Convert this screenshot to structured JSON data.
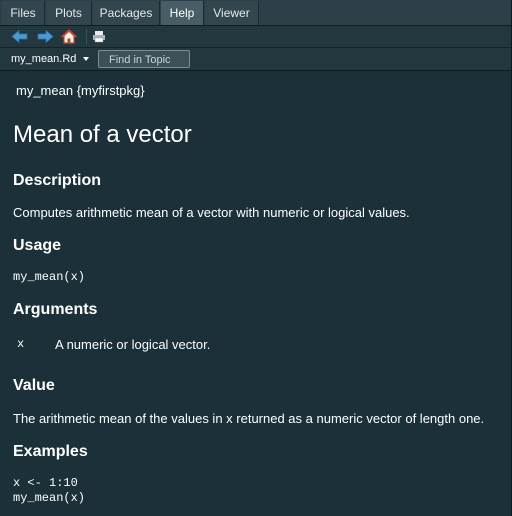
{
  "tabs": [
    {
      "label": "Files",
      "active": false
    },
    {
      "label": "Plots",
      "active": false
    },
    {
      "label": "Packages",
      "active": false
    },
    {
      "label": "Help",
      "active": true
    },
    {
      "label": "Viewer",
      "active": false
    }
  ],
  "toolbar": {
    "icons": [
      "back-arrow-icon",
      "forward-arrow-icon",
      "home-icon",
      "print-icon"
    ]
  },
  "topic_bar": {
    "topic": "my_mean.Rd",
    "find_placeholder": "Find in Topic"
  },
  "help_page": {
    "header": "my_mean {myfirstpkg}",
    "title": "Mean of a vector",
    "description_heading": "Description",
    "description": "Computes arithmetic mean of a vector with numeric or logical values.",
    "usage_heading": "Usage",
    "usage_code": "my_mean(x)",
    "arguments_heading": "Arguments",
    "argument_name": "x",
    "argument_desc": "A numeric or logical vector.",
    "value_heading": "Value",
    "value_text": "The arithmetic mean of the values in x returned as a numeric vector of length one.",
    "examples_heading": "Examples",
    "example_line1": "x <- 1:10",
    "example_line2": "my_mean(x)"
  },
  "colors": {
    "background": "#1b3038",
    "tab_active": "#495d66",
    "arrow_blue": "#4a9ad8",
    "home_red": "#d3432f"
  }
}
